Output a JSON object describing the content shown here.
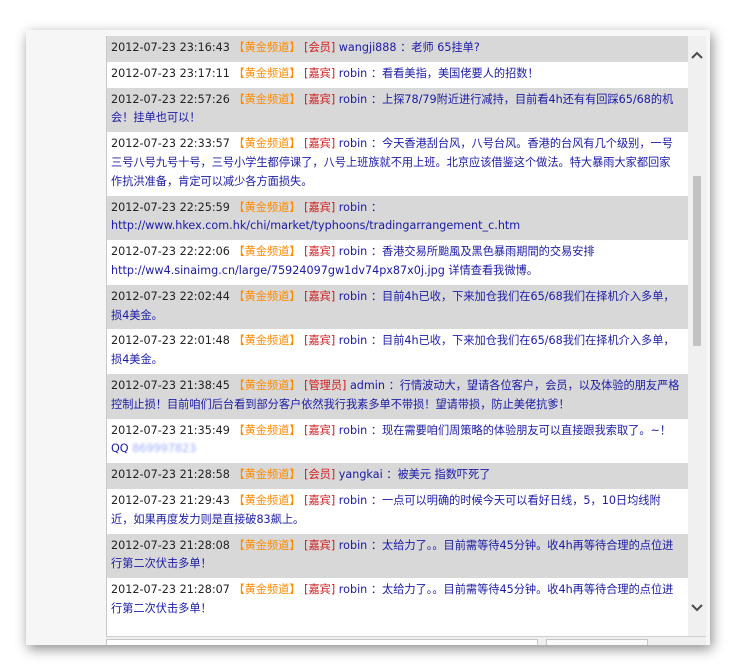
{
  "messages": [
    {
      "time": "2012-07-23 23:16:43",
      "channel": "【黄金频道】",
      "role": "[会员]",
      "user": "wangji888",
      "text": "：老师 65挂单?"
    },
    {
      "time": "2012-07-23 23:17:11",
      "channel": "【黄金频道】",
      "role": "[嘉宾]",
      "user": "robin",
      "text": "：看看美指，美国佬要人的招数！"
    },
    {
      "time": "2012-07-23 22:57:26",
      "channel": "【黄金频道】",
      "role": "[嘉宾]",
      "user": "robin",
      "text": "：上探78/79附近进行减持，目前看4h还有有回踩65/68的机会！挂单也可以！"
    },
    {
      "time": "2012-07-23 22:33:57",
      "channel": "【黄金频道】",
      "role": "[嘉宾]",
      "user": "robin",
      "text": "：今天香港刮台风，八号台风。香港的台风有几个级别，一号三号八号九号十号，三号小学生都停课了，八号上班族就不用上班。北京应该借鉴这个做法。特大暴雨大家都回家作抗洪准备，肯定可以减少各方面损失。"
    },
    {
      "time": "2012-07-23 22:25:59",
      "channel": "【黄金频道】",
      "role": "[嘉宾]",
      "user": "robin",
      "text": "：",
      "link": "http://www.hkex.com.hk/chi/market/typhoons/tradingarrangement_c.htm"
    },
    {
      "time": "2012-07-23 22:22:06",
      "channel": "【黄金频道】",
      "role": "[嘉宾]",
      "user": "robin",
      "text": "：香港交易所颱風及黑色暴雨期間的交易安排",
      "link": "http://ww4.sinaimg.cn/large/75924097gw1dv74px87x0j.jpg 详情查看我微博。"
    },
    {
      "time": "2012-07-23 22:02:44",
      "channel": "【黄金频道】",
      "role": "[嘉宾]",
      "user": "robin",
      "text": "：目前4h已收，下来加仓我们在65/68我们在择机介入多单，损4美金。"
    },
    {
      "time": "2012-07-23 22:01:48",
      "channel": "【黄金频道】",
      "role": "[嘉宾]",
      "user": "robin",
      "text": "：目前4h已收，下来加仓我们在65/68我们在择机介入多单，损4美金。"
    },
    {
      "time": "2012-07-23 21:38:45",
      "channel": "【黄金频道】",
      "role": "[管理员]",
      "user": "admin",
      "text": "：行情波动大，望请各位客户，会员，以及体验的朋友严格控制止损！目前咱们后台看到部分客户依然我行我素多单不带损！望请带损，防止美佬抗爹！"
    },
    {
      "time": "2012-07-23 21:35:49",
      "channel": "【黄金频道】",
      "role": "[嘉宾]",
      "user": "robin",
      "text": "：现在需要咱们周策略的体验朋友可以直接跟我索取了。~！ QQ ",
      "blur": "869997823"
    },
    {
      "time": "2012-07-23 21:28:58",
      "channel": "【黄金频道】",
      "role": "[会员]",
      "user": "yangkai",
      "text": "：被美元 指数吓死了"
    },
    {
      "time": "2012-07-23 21:29:43",
      "channel": "【黄金频道】",
      "role": "[嘉宾]",
      "user": "robin",
      "text": "：一点可以明确的时候今天可以看好日线，5，10日均线附近，如果再度发力则是直接破83飙上。"
    },
    {
      "time": "2012-07-23 21:28:08",
      "channel": "【黄金频道】",
      "role": "[嘉宾]",
      "user": "robin",
      "text": "：太给力了。。目前需等待45分钟。收4h再等待合理的点位进行第二次伏击多单！"
    },
    {
      "time": "2012-07-23 21:28:07",
      "channel": "【黄金频道】",
      "role": "[嘉宾]",
      "user": "robin",
      "text": "：太给力了。。目前需等待45分钟。收4h再等待合理的点位进行第二次伏击多单！"
    }
  ],
  "scrollbar": {
    "up_icon": "▲",
    "down_icon": "▼"
  },
  "colors": {
    "channel": "#ff8a00",
    "role": "#d01b1b",
    "text": "#1a1aa6",
    "alt_row": "#d8d8d8"
  }
}
